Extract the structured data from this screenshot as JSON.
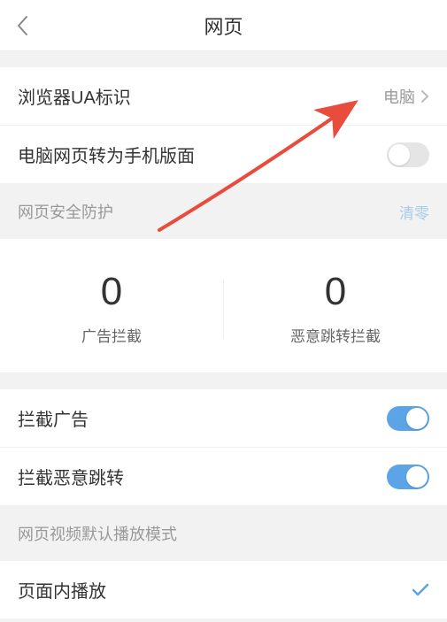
{
  "header": {
    "title": "网页"
  },
  "ua_row": {
    "label": "浏览器UA标识",
    "value": "电脑"
  },
  "desktop_to_mobile_row": {
    "label": "电脑网页转为手机版面",
    "enabled": false
  },
  "security_section": {
    "label": "网页安全防护",
    "action": "清零"
  },
  "stats": {
    "ad_block": {
      "value": "0",
      "label": "广告拦截"
    },
    "malicious_redirect": {
      "value": "0",
      "label": "恶意跳转拦截"
    }
  },
  "block_ads_row": {
    "label": "拦截广告",
    "enabled": true
  },
  "block_redirect_row": {
    "label": "拦截恶意跳转",
    "enabled": true
  },
  "video_section": {
    "label": "网页视频默认播放模式"
  },
  "inline_play_row": {
    "label": "页面内播放",
    "selected": true
  }
}
